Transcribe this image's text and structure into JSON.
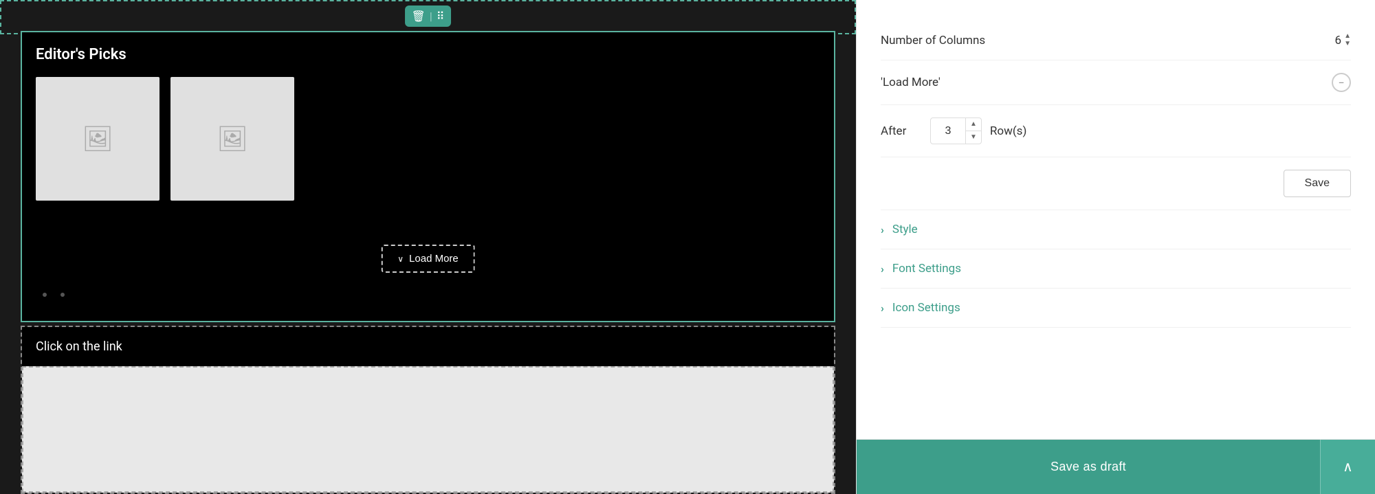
{
  "canvas": {
    "editors_picks_title": "Editor's Picks",
    "load_more_label": "Load More",
    "click_link_label": "Click on the link"
  },
  "toolbar": {
    "delete_icon": "🗑",
    "drag_icon": "⠿"
  },
  "panel": {
    "columns_label": "Number of Columns",
    "columns_value": "6",
    "load_more_label": "'Load More'",
    "after_label": "After",
    "after_value": "3",
    "rows_label": "Row(s)",
    "save_label": "Save",
    "style_label": "Style",
    "font_settings_label": "Font Settings",
    "icon_settings_label": "Icon Settings",
    "save_draft_label": "Save as draft",
    "expand_icon": "⌃"
  }
}
